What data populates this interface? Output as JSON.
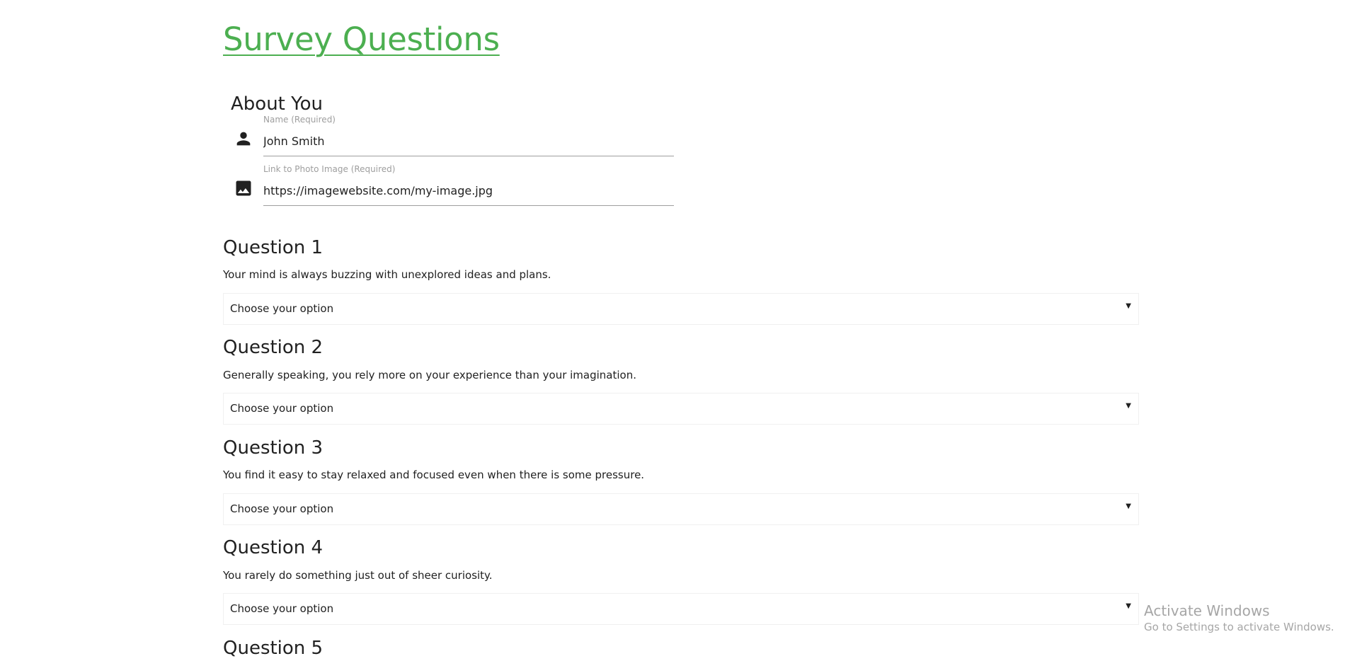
{
  "page": {
    "title": "Survey Questions",
    "accent_color": "#4caf50"
  },
  "about": {
    "heading": "About You",
    "name": {
      "icon": "person-icon",
      "label": "Name (Required)",
      "value": "John Smith"
    },
    "photo": {
      "icon": "image-icon",
      "label": "Link to Photo Image (Required)",
      "value": "https://imagewebsite.com/my-image.jpg"
    }
  },
  "questions": [
    {
      "heading": "Question 1",
      "text": "Your mind is always buzzing with unexplored ideas and plans.",
      "selected": "Choose your option"
    },
    {
      "heading": "Question 2",
      "text": "Generally speaking, you rely more on your experience than your imagination.",
      "selected": "Choose your option"
    },
    {
      "heading": "Question 3",
      "text": "You find it easy to stay relaxed and focused even when there is some pressure.",
      "selected": "Choose your option"
    },
    {
      "heading": "Question 4",
      "text": "You rarely do something just out of sheer curiosity.",
      "selected": "Choose your option"
    },
    {
      "heading": "Question 5"
    }
  ],
  "select_caret": "▼",
  "watermark": {
    "title": "Activate Windows",
    "subtitle": "Go to Settings to activate Windows."
  }
}
